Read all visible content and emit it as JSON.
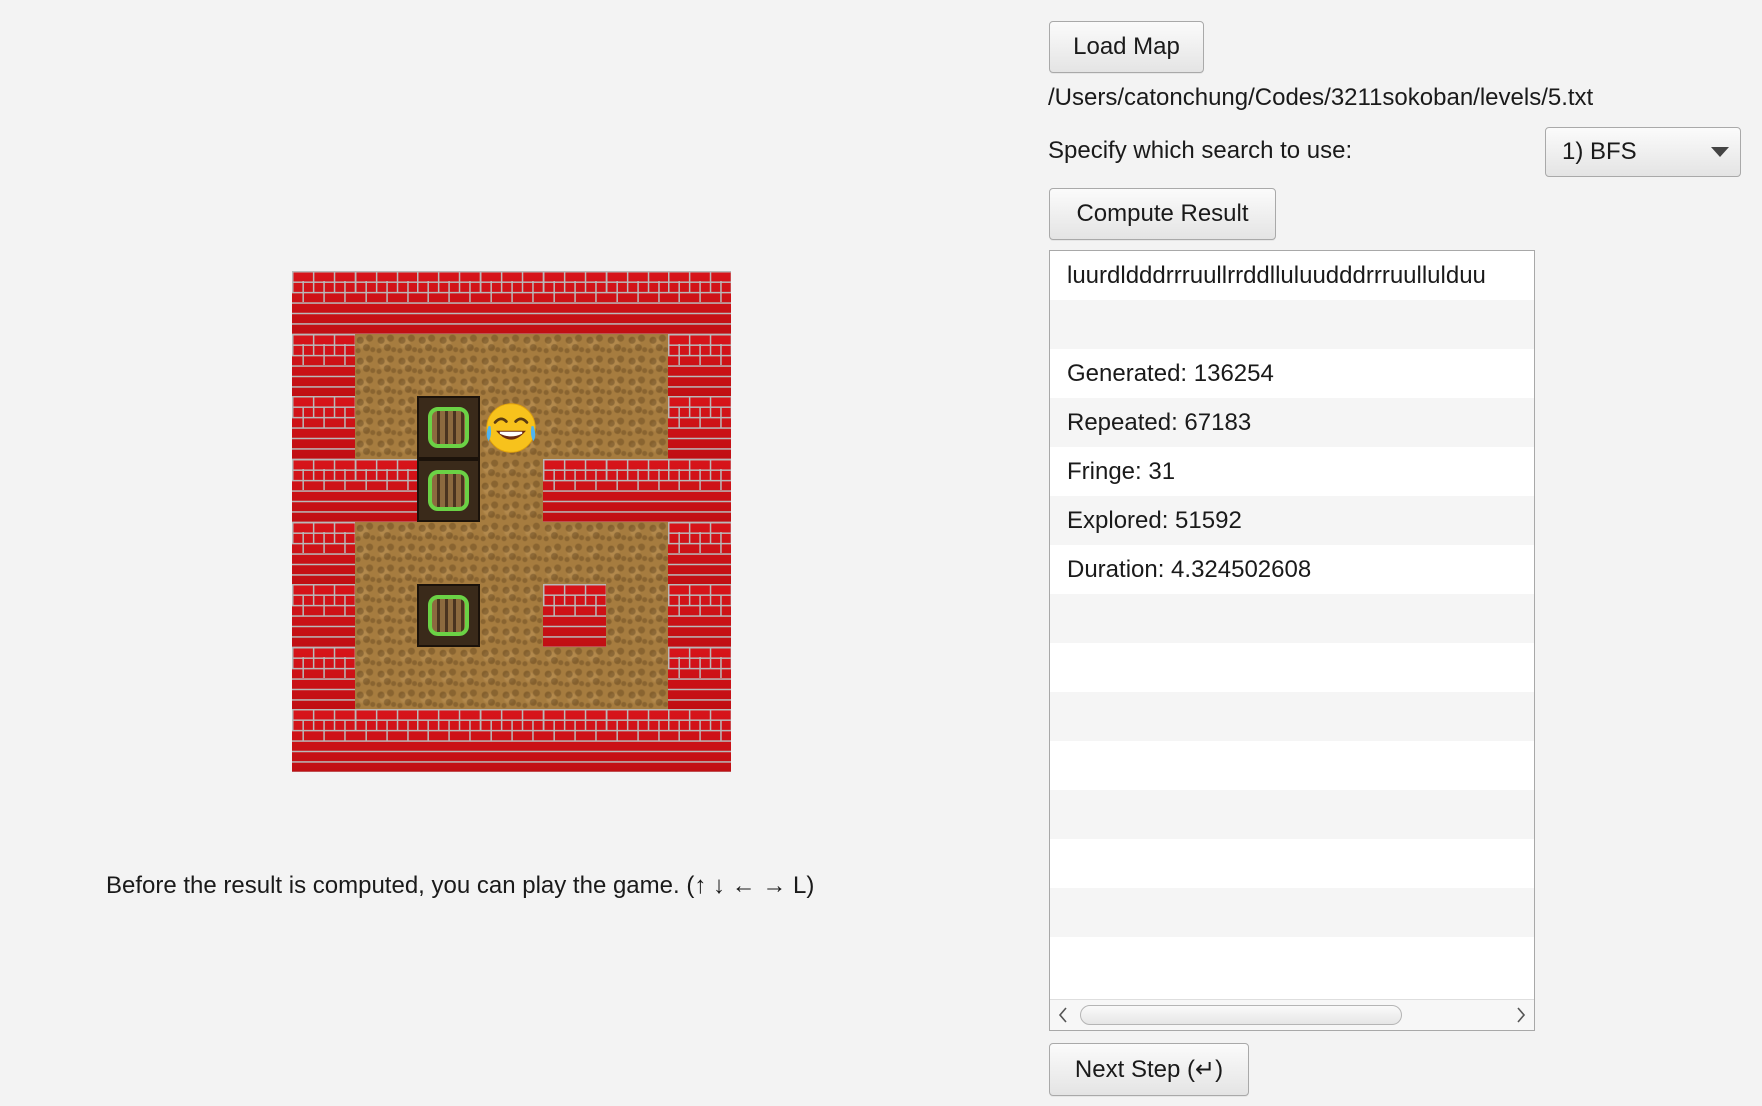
{
  "game": {
    "grid": [
      "WWWWWWW",
      "W.....W",
      "W.B+..W",
      "WWB.WWW",
      "W.....W",
      "W.B.W.W",
      "W.....W",
      "WWWWWWW"
    ],
    "hint": "Before the result is computed, you can play the game. (↑ ↓ ← → L)"
  },
  "controls": {
    "load_label": "Load Map",
    "file_path": "/Users/catonchung/Codes/3211sokoban/levels/5.txt",
    "search_label": "Specify which search to use:",
    "search_selected": "1) BFS",
    "compute_label": "Compute Result",
    "next_label": "Next Step (↵)"
  },
  "results": {
    "rows": [
      "luurdldddrrruullrrddlluluudddrrruullulduu",
      "",
      "Generated: 136254",
      "Repeated: 67183",
      "Fringe: 31",
      "Explored: 51592",
      "Duration: 4.324502608",
      "",
      "",
      "",
      "",
      "",
      "",
      "",
      ""
    ]
  },
  "icons": {
    "player": "tears-of-joy-face-icon",
    "box": "crate-icon",
    "select": "chevron-down-icon",
    "scroll_left": "chevron-left-icon",
    "scroll_right": "chevron-right-icon"
  }
}
